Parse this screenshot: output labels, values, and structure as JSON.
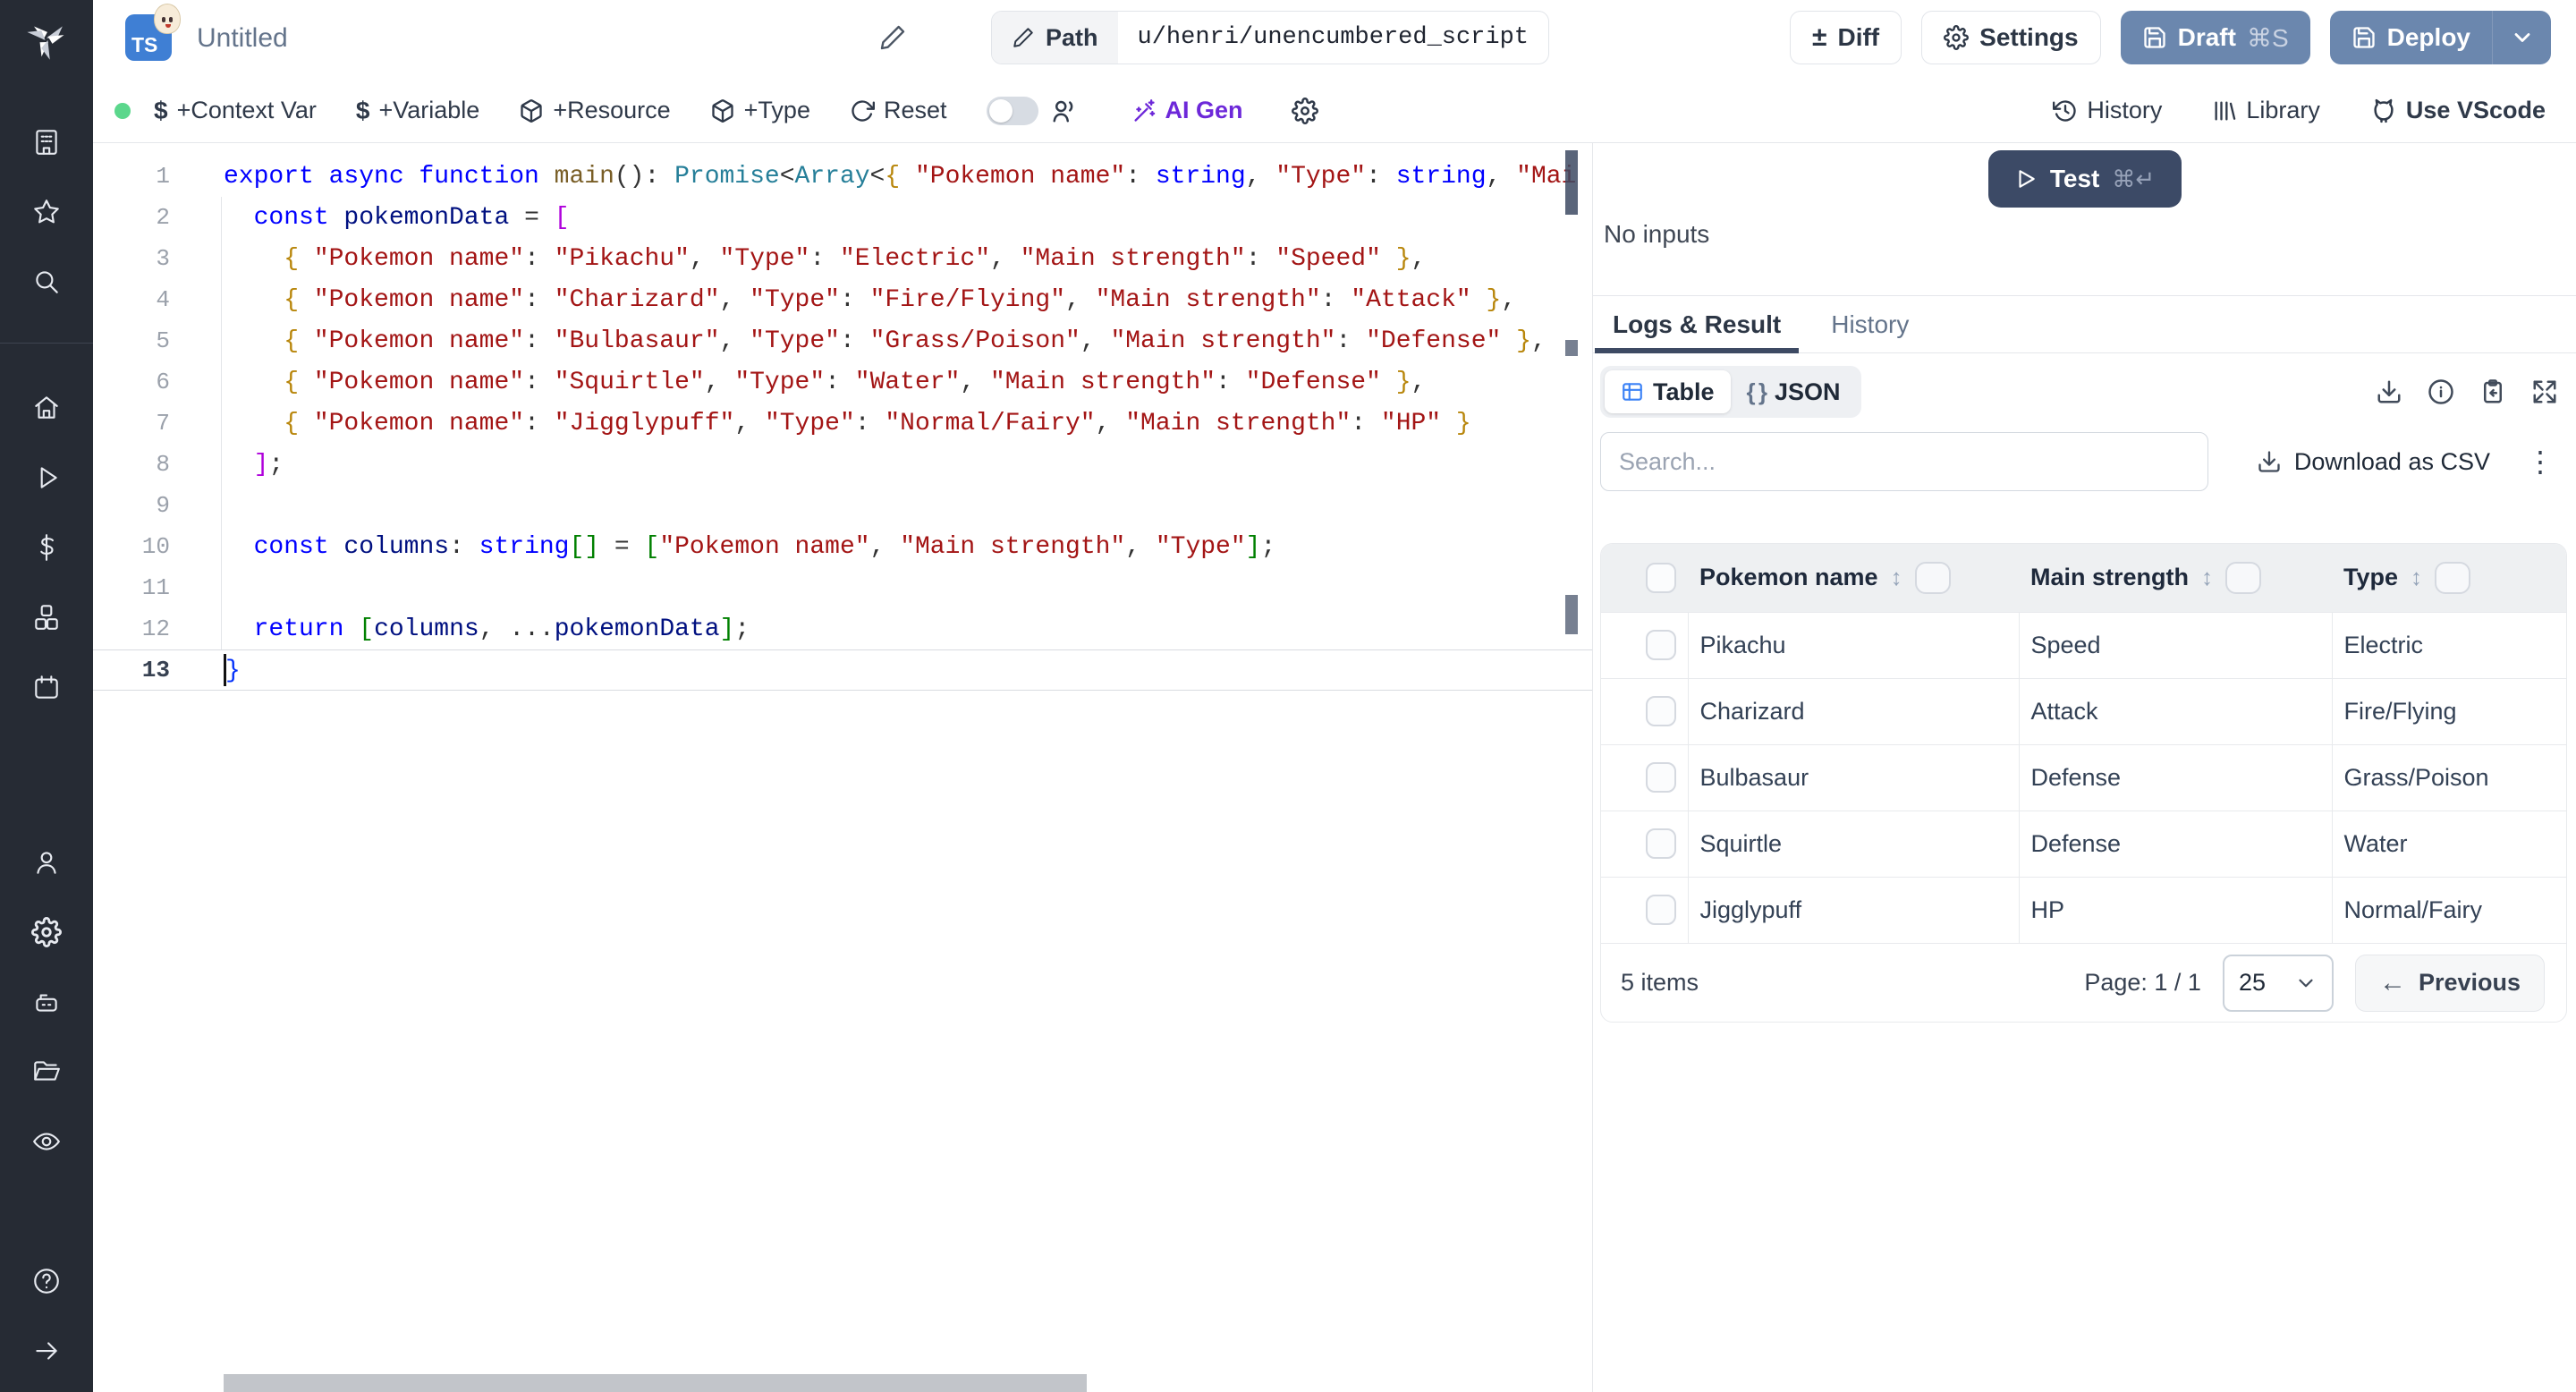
{
  "app": {
    "title": "Untitled",
    "path_label": "Path",
    "path_value": "u/henri/unencumbered_script",
    "language_badge": "TS"
  },
  "header_buttons": {
    "diff": "Diff",
    "settings": "Settings",
    "draft": "Draft",
    "draft_shortcut": "⌘S",
    "deploy": "Deploy"
  },
  "toolbar": {
    "context_var": "+Context Var",
    "variable": "+Variable",
    "resource": "+Resource",
    "type": "+Type",
    "reset": "Reset",
    "ai_gen": "AI Gen",
    "history": "History",
    "library": "Library",
    "vscode": "Use VScode"
  },
  "icons_glyphs": {
    "diff": "±",
    "dollar": "$",
    "sort": "↕",
    "kebab": "⋮",
    "prev_arrow": "←",
    "json_braces": "{ }"
  },
  "sidebar": {
    "icons": [
      "windmill-logo",
      "building",
      "star",
      "search",
      "home",
      "play",
      "dollar",
      "cubes",
      "calendar",
      "person",
      "gear",
      "robot",
      "folder",
      "eye",
      "help",
      "arrow-right"
    ]
  },
  "editor": {
    "active_line": 13,
    "lines": [
      {
        "n": 1,
        "tokens": [
          [
            "kw",
            "export async function"
          ],
          [
            "fn",
            " main"
          ],
          [
            "pu",
            "(): "
          ],
          [
            "ty",
            "Promise"
          ],
          [
            "pu",
            "<"
          ],
          [
            "ty",
            "Array"
          ],
          [
            "pu",
            "<"
          ],
          [
            "bg",
            "{"
          ],
          [
            "st",
            " \"Pokemon name\""
          ],
          [
            "pu",
            ": "
          ],
          [
            "kw",
            "string"
          ],
          [
            "pu",
            ", "
          ],
          [
            "st",
            "\"Type\""
          ],
          [
            "pu",
            ": "
          ],
          [
            "kw",
            "string"
          ],
          [
            "pu",
            ", "
          ],
          [
            "st",
            "\"Mai"
          ]
        ]
      },
      {
        "n": 2,
        "tokens": [
          [
            "pu",
            "  "
          ],
          [
            "kw",
            "const"
          ],
          [
            "va",
            " pokemonData"
          ],
          [
            "pu",
            " = "
          ],
          [
            "bp",
            "["
          ]
        ]
      },
      {
        "n": 3,
        "tokens": [
          [
            "pu",
            "    "
          ],
          [
            "bg",
            "{ "
          ],
          [
            "st",
            "\"Pokemon name\""
          ],
          [
            "pu",
            ": "
          ],
          [
            "st",
            "\"Pikachu\""
          ],
          [
            "pu",
            ", "
          ],
          [
            "st",
            "\"Type\""
          ],
          [
            "pu",
            ": "
          ],
          [
            "st",
            "\"Electric\""
          ],
          [
            "pu",
            ", "
          ],
          [
            "st",
            "\"Main strength\""
          ],
          [
            "pu",
            ": "
          ],
          [
            "st",
            "\"Speed\""
          ],
          [
            "bg",
            " }"
          ],
          [
            "pu",
            ","
          ]
        ]
      },
      {
        "n": 4,
        "tokens": [
          [
            "pu",
            "    "
          ],
          [
            "bg",
            "{ "
          ],
          [
            "st",
            "\"Pokemon name\""
          ],
          [
            "pu",
            ": "
          ],
          [
            "st",
            "\"Charizard\""
          ],
          [
            "pu",
            ", "
          ],
          [
            "st",
            "\"Type\""
          ],
          [
            "pu",
            ": "
          ],
          [
            "st",
            "\"Fire/Flying\""
          ],
          [
            "pu",
            ", "
          ],
          [
            "st",
            "\"Main strength\""
          ],
          [
            "pu",
            ": "
          ],
          [
            "st",
            "\"Attack\""
          ],
          [
            "bg",
            " }"
          ],
          [
            "pu",
            ","
          ]
        ]
      },
      {
        "n": 5,
        "tokens": [
          [
            "pu",
            "    "
          ],
          [
            "bg",
            "{ "
          ],
          [
            "st",
            "\"Pokemon name\""
          ],
          [
            "pu",
            ": "
          ],
          [
            "st",
            "\"Bulbasaur\""
          ],
          [
            "pu",
            ", "
          ],
          [
            "st",
            "\"Type\""
          ],
          [
            "pu",
            ": "
          ],
          [
            "st",
            "\"Grass/Poison\""
          ],
          [
            "pu",
            ", "
          ],
          [
            "st",
            "\"Main strength\""
          ],
          [
            "pu",
            ": "
          ],
          [
            "st",
            "\"Defense\""
          ],
          [
            "bg",
            " }"
          ],
          [
            "pu",
            ","
          ]
        ]
      },
      {
        "n": 6,
        "tokens": [
          [
            "pu",
            "    "
          ],
          [
            "bg",
            "{ "
          ],
          [
            "st",
            "\"Pokemon name\""
          ],
          [
            "pu",
            ": "
          ],
          [
            "st",
            "\"Squirtle\""
          ],
          [
            "pu",
            ", "
          ],
          [
            "st",
            "\"Type\""
          ],
          [
            "pu",
            ": "
          ],
          [
            "st",
            "\"Water\""
          ],
          [
            "pu",
            ", "
          ],
          [
            "st",
            "\"Main strength\""
          ],
          [
            "pu",
            ": "
          ],
          [
            "st",
            "\"Defense\""
          ],
          [
            "bg",
            " }"
          ],
          [
            "pu",
            ","
          ]
        ]
      },
      {
        "n": 7,
        "tokens": [
          [
            "pu",
            "    "
          ],
          [
            "bg",
            "{ "
          ],
          [
            "st",
            "\"Pokemon name\""
          ],
          [
            "pu",
            ": "
          ],
          [
            "st",
            "\"Jigglypuff\""
          ],
          [
            "pu",
            ", "
          ],
          [
            "st",
            "\"Type\""
          ],
          [
            "pu",
            ": "
          ],
          [
            "st",
            "\"Normal/Fairy\""
          ],
          [
            "pu",
            ", "
          ],
          [
            "st",
            "\"Main strength\""
          ],
          [
            "pu",
            ": "
          ],
          [
            "st",
            "\"HP\""
          ],
          [
            "bg",
            " }"
          ]
        ]
      },
      {
        "n": 8,
        "tokens": [
          [
            "pu",
            "  "
          ],
          [
            "bp",
            "]"
          ],
          [
            "pu",
            ";"
          ]
        ]
      },
      {
        "n": 9,
        "tokens": []
      },
      {
        "n": 10,
        "tokens": [
          [
            "pu",
            "  "
          ],
          [
            "kw",
            "const"
          ],
          [
            "va",
            " columns"
          ],
          [
            "pu",
            ": "
          ],
          [
            "kw",
            "string"
          ],
          [
            "bgr",
            "[]"
          ],
          [
            "pu",
            " = "
          ],
          [
            "bgr",
            "["
          ],
          [
            "st",
            "\"Pokemon name\""
          ],
          [
            "pu",
            ", "
          ],
          [
            "st",
            "\"Main strength\""
          ],
          [
            "pu",
            ", "
          ],
          [
            "st",
            "\"Type\""
          ],
          [
            "bgr",
            "]"
          ],
          [
            "pu",
            ";"
          ]
        ]
      },
      {
        "n": 11,
        "tokens": []
      },
      {
        "n": 12,
        "tokens": [
          [
            "pu",
            "  "
          ],
          [
            "kw",
            "return"
          ],
          [
            "pu",
            " "
          ],
          [
            "bgr",
            "["
          ],
          [
            "va",
            "columns"
          ],
          [
            "pu",
            ", ..."
          ],
          [
            "va",
            "pokemonData"
          ],
          [
            "bgr",
            "]"
          ],
          [
            "pu",
            ";"
          ]
        ]
      },
      {
        "n": 13,
        "tokens": [
          [
            "bb",
            "}"
          ]
        ]
      }
    ]
  },
  "run_panel": {
    "test_label": "Test",
    "test_shortcut": "⌘↵",
    "no_inputs": "No inputs",
    "tabs": {
      "logs": "Logs & Result",
      "history": "History"
    },
    "active_tab": "Logs & Result"
  },
  "result": {
    "view_table": "Table",
    "view_json": "JSON",
    "search_placeholder": "Search...",
    "download_csv": "Download as CSV",
    "table": {
      "columns": [
        "Pokemon name",
        "Main strength",
        "Type"
      ],
      "rows": [
        [
          "Pikachu",
          "Speed",
          "Electric"
        ],
        [
          "Charizard",
          "Attack",
          "Fire/Flying"
        ],
        [
          "Bulbasaur",
          "Defense",
          "Grass/Poison"
        ],
        [
          "Squirtle",
          "Defense",
          "Water"
        ],
        [
          "Jigglypuff",
          "HP",
          "Normal/Fairy"
        ]
      ],
      "footer": {
        "items": "5 items",
        "page": "Page: 1 / 1",
        "page_size": "25",
        "previous": "Previous"
      }
    }
  },
  "colors": {
    "sidebar_bg": "#262b34",
    "solid_button": "#6b87ae",
    "test_button": "#3c4a66",
    "accent_purple": "#6d28d9",
    "status_green": "#5bd78c",
    "table_icon_blue": "#3b82f6",
    "code_keyword": "#0000ff",
    "code_string": "#a31515",
    "code_type": "#267f99"
  }
}
